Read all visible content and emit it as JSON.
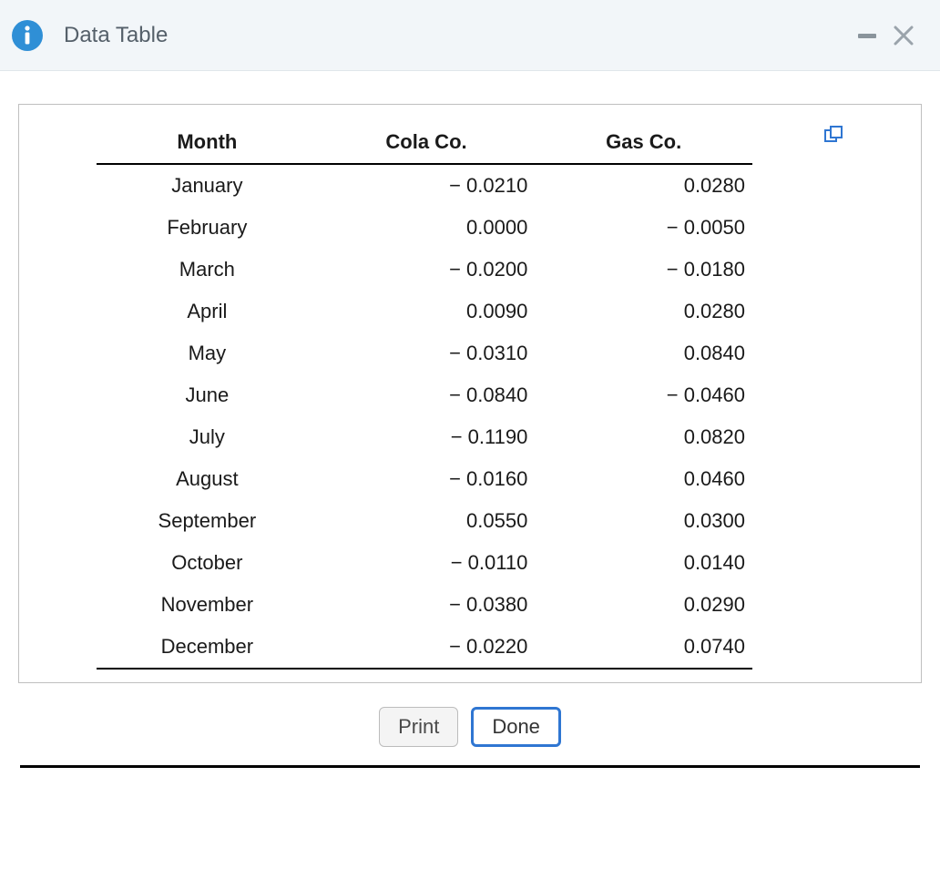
{
  "header": {
    "title": "Data Table"
  },
  "table": {
    "headers": [
      "Month",
      "Cola Co.",
      "Gas Co."
    ],
    "rows": [
      {
        "month": "January",
        "cola": "− 0.0210",
        "gas": "0.0280"
      },
      {
        "month": "February",
        "cola": "0.0000",
        "gas": "− 0.0050"
      },
      {
        "month": "March",
        "cola": "− 0.0200",
        "gas": "− 0.0180"
      },
      {
        "month": "April",
        "cola": "0.0090",
        "gas": "0.0280"
      },
      {
        "month": "May",
        "cola": "− 0.0310",
        "gas": "0.0840"
      },
      {
        "month": "June",
        "cola": "− 0.0840",
        "gas": "− 0.0460"
      },
      {
        "month": "July",
        "cola": "− 0.1190",
        "gas": "0.0820"
      },
      {
        "month": "August",
        "cola": "− 0.0160",
        "gas": "0.0460"
      },
      {
        "month": "September",
        "cola": "0.0550",
        "gas": "0.0300"
      },
      {
        "month": "October",
        "cola": "− 0.0110",
        "gas": "0.0140"
      },
      {
        "month": "November",
        "cola": "− 0.0380",
        "gas": "0.0290"
      },
      {
        "month": "December",
        "cola": "− 0.0220",
        "gas": "0.0740"
      }
    ]
  },
  "buttons": {
    "print": "Print",
    "done": "Done"
  }
}
